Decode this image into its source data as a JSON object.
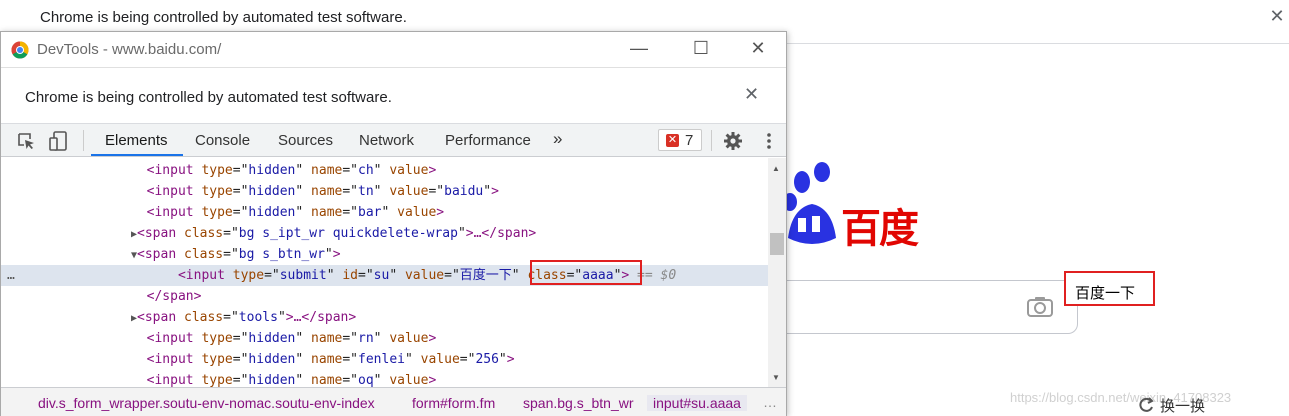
{
  "background_page": {
    "infobar_message": "Chrome is being controlled by automated test software.",
    "infobar_close": "✕",
    "logo_text": "百度",
    "search_button_label": "百度一下",
    "watermark": "https://blog.csdn.net/weixin_41708323",
    "swap_label": "换一换"
  },
  "devtools": {
    "window_title": "DevTools - www.baidu.com/",
    "infobar_message": "Chrome is being controlled by automated test software.",
    "infobar_close": "✕",
    "window_controls": {
      "minimize": "—",
      "maximize": "☐",
      "close": "✕"
    },
    "tabs": [
      {
        "label": "Elements",
        "active": true
      },
      {
        "label": "Console",
        "active": false
      },
      {
        "label": "Sources",
        "active": false
      },
      {
        "label": "Network",
        "active": false
      },
      {
        "label": "Performance",
        "active": false
      }
    ],
    "more_tabs": "»",
    "error_count": "7",
    "error_badge_icon": "✕",
    "dom_lines": [
      {
        "indent": "    ",
        "open": "<input",
        "parts": [
          [
            "type",
            "hidden"
          ],
          [
            "name",
            "ch"
          ]
        ],
        "bare": "value",
        "close": ">"
      },
      {
        "indent": "    ",
        "open": "<input",
        "parts": [
          [
            "type",
            "hidden"
          ],
          [
            "name",
            "tn"
          ],
          [
            "value",
            "baidu"
          ]
        ],
        "bare": "",
        "close": ">"
      },
      {
        "indent": "    ",
        "open": "<input",
        "parts": [
          [
            "type",
            "hidden"
          ],
          [
            "name",
            "bar"
          ]
        ],
        "bare": "value",
        "close": ">"
      },
      {
        "indent": "   ",
        "tri": "▶",
        "open": "<span",
        "parts": [
          [
            "class",
            "bg s_ipt_wr quickdelete-wrap"
          ]
        ],
        "bare": "",
        "close": ">…</span>"
      },
      {
        "indent": "   ",
        "tri": "▼",
        "open": "<span",
        "parts": [
          [
            "class",
            "bg s_btn_wr"
          ]
        ],
        "bare": "",
        "close": ">"
      },
      {
        "indent": "      ",
        "open": "<input",
        "parts": [
          [
            "type",
            "submit"
          ],
          [
            "id",
            "su"
          ],
          [
            "value",
            "百度一下"
          ],
          [
            "class",
            "aaaa"
          ]
        ],
        "bare": "",
        "close": ">",
        "suffix": " == $0",
        "selected": true
      },
      {
        "indent": "    ",
        "open": "</span>",
        "parts": [],
        "bare": "",
        "close": ""
      },
      {
        "indent": "   ",
        "tri": "▶",
        "open": "<span",
        "parts": [
          [
            "class",
            "tools"
          ]
        ],
        "bare": "",
        "close": ">…</span>"
      },
      {
        "indent": "    ",
        "open": "<input",
        "parts": [
          [
            "type",
            "hidden"
          ],
          [
            "name",
            "rn"
          ]
        ],
        "bare": "value",
        "close": ">"
      },
      {
        "indent": "    ",
        "open": "<input",
        "parts": [
          [
            "type",
            "hidden"
          ],
          [
            "name",
            "fenlei"
          ],
          [
            "value",
            "256"
          ]
        ],
        "bare": "",
        "close": ">"
      },
      {
        "indent": "    ",
        "open": "<input",
        "parts": [
          [
            "type",
            "hidden"
          ],
          [
            "name",
            "oq"
          ]
        ],
        "bare": "value",
        "close": ">"
      }
    ],
    "breadcrumbs": [
      {
        "label": "div.s_form_wrapper.soutu-env-nomac.soutu-env-index",
        "active": false
      },
      {
        "label": "form#form.fm",
        "active": false
      },
      {
        "label": "span.bg.s_btn_wr",
        "active": false
      },
      {
        "label": "input#su.aaaa",
        "active": true
      }
    ],
    "breadcrumb_more": "…",
    "selected_row_dots": "…"
  }
}
